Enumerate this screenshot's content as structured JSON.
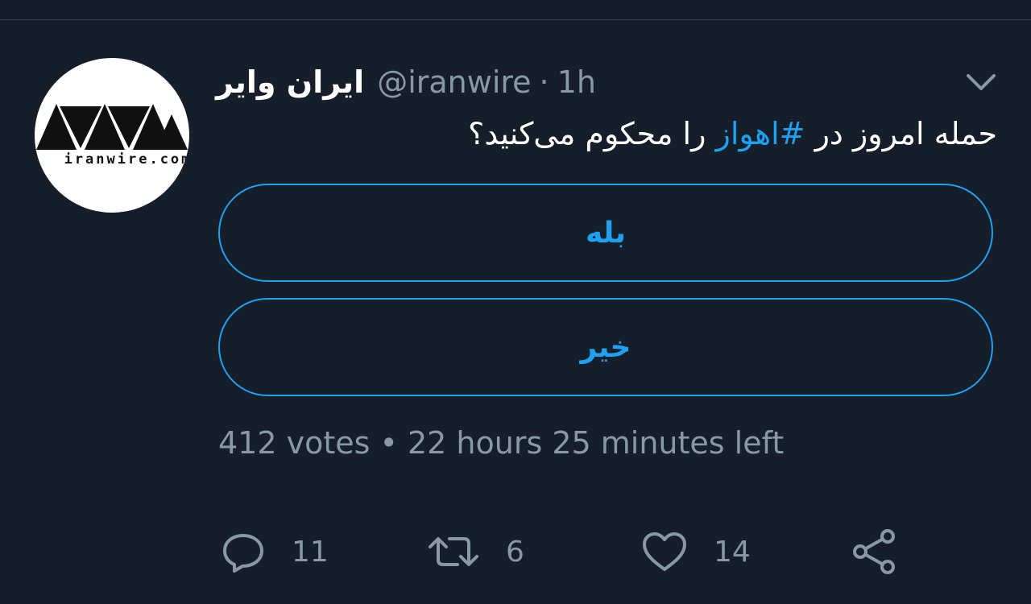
{
  "tweet": {
    "author": {
      "display_name": "ایران وایر",
      "handle": "@iranwire",
      "avatar_text": "iranwire.com"
    },
    "separator": "·",
    "time": "1h",
    "text_before": "حمله امروز در ",
    "hashtag": "#اهواز",
    "text_after": " را محکوم می‌کنید؟",
    "menu_icon": "chevron-down-icon"
  },
  "poll": {
    "options": [
      {
        "label": "بله"
      },
      {
        "label": "خیر"
      }
    ],
    "meta": "412 votes • 22 hours 25 minutes left"
  },
  "actions": {
    "reply_count": "11",
    "retweet_count": "6",
    "like_count": "14",
    "share_icon": "share-icon"
  },
  "colors": {
    "background": "#151e29",
    "accent": "#1da1f2",
    "muted": "#8899a6",
    "text": "#ffffff"
  }
}
